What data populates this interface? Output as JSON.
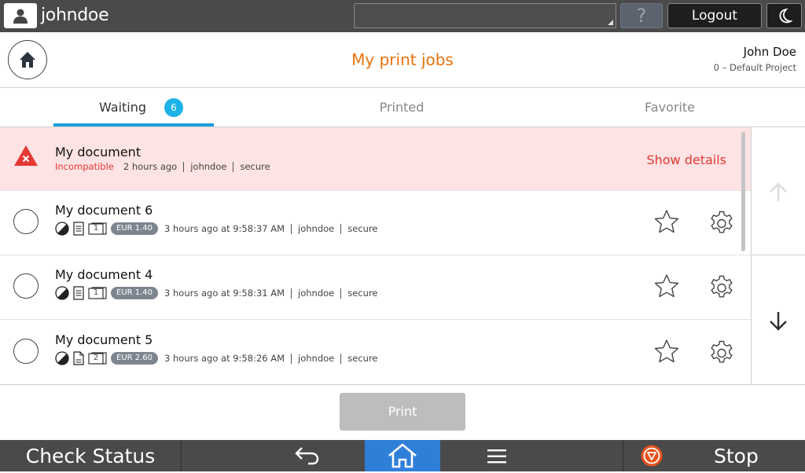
{
  "topbar": {
    "username": "johndoe",
    "help_label": "?",
    "logout_label": "Logout"
  },
  "header": {
    "title": "My print jobs",
    "account_name": "John Doe",
    "project": "0 – Default Project"
  },
  "tabs": [
    {
      "label": "Waiting",
      "badge": "6",
      "active": true
    },
    {
      "label": "Printed",
      "active": false
    },
    {
      "label": "Favorite",
      "active": false
    }
  ],
  "jobs": {
    "error_row": {
      "title": "My document",
      "status": "Incompatible",
      "time": "2 hours ago",
      "user": "johndoe",
      "queue": "secure",
      "action": "Show details"
    },
    "rows": [
      {
        "title": "My document 6",
        "copies": "1",
        "price": "EUR 1.40",
        "time": "3 hours ago at 9:58:37 AM",
        "user": "johndoe",
        "queue": "secure"
      },
      {
        "title": "My document 4",
        "copies": "1",
        "price": "EUR 1.40",
        "time": "3 hours ago at 9:58:31 AM",
        "user": "johndoe",
        "queue": "secure"
      },
      {
        "title": "My document 5",
        "copies": "2",
        "price": "EUR 2.60",
        "time": "3 hours ago at 9:58:26 AM",
        "user": "johndoe",
        "queue": "secure"
      }
    ]
  },
  "footer": {
    "print_label": "Print"
  },
  "bottombar": {
    "check_status": "Check Status",
    "stop": "Stop"
  },
  "colors": {
    "accent": "#e8730c",
    "tab_active": "#1aa0dc",
    "error_bg": "#fde3e3",
    "error_text": "#e53935",
    "home_active": "#2f7fd8"
  }
}
